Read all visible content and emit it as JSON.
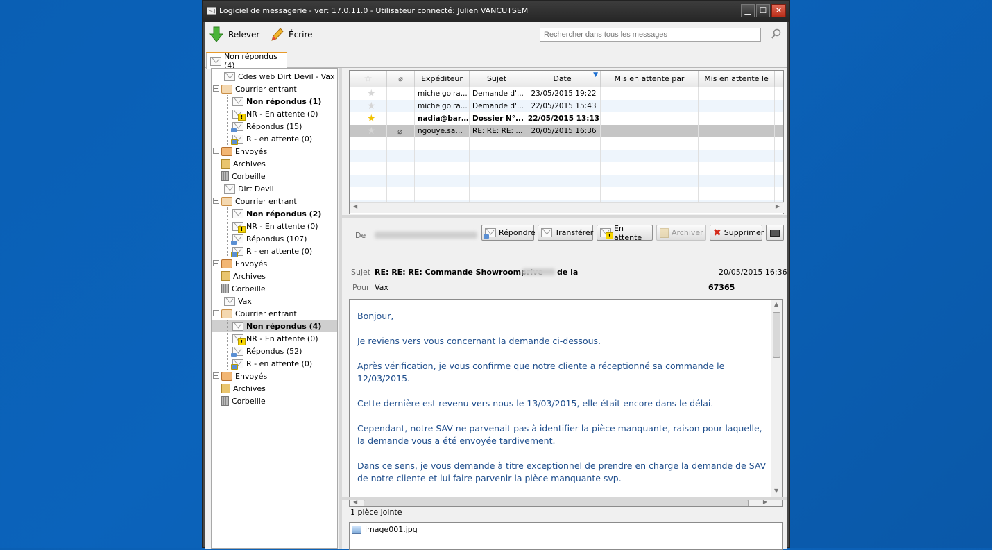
{
  "window": {
    "title": "Logiciel de messagerie - ver: 17.0.11.0 - Utilisateur connecté: Julien VANCUTSEM",
    "minimize": "▁",
    "maximize": "☐",
    "close": "✕"
  },
  "toolbar": {
    "fetch_label": "Relever",
    "write_label": "Écrire",
    "search_placeholder": "Rechercher dans tous les messages"
  },
  "tab": {
    "label": "Non répondus (4)"
  },
  "tree": [
    {
      "label": "Cdes web Dirt Devil - Vax",
      "icon": "mail-icon"
    },
    {
      "label": "Courrier entrant",
      "icon": "inbox-icon"
    },
    {
      "label": "Non répondus (1)",
      "icon": "envelope-icon"
    },
    {
      "label": "NR - En attente (0)",
      "icon": "envelope-warning-icon"
    },
    {
      "label": "Répondus (15)",
      "icon": "envelope-reply-icon"
    },
    {
      "label": "R - en attente (0)",
      "icon": "envelope-reply-warning-icon"
    },
    {
      "label": "Envoyés",
      "icon": "sent-icon"
    },
    {
      "label": "Archives",
      "icon": "archive-icon"
    },
    {
      "label": "Corbeille",
      "icon": "trash-icon"
    },
    {
      "label": "Dirt Devil",
      "icon": "mail-icon"
    },
    {
      "label": "Courrier entrant",
      "icon": "inbox-icon"
    },
    {
      "label": "Non répondus (2)",
      "icon": "envelope-icon"
    },
    {
      "label": "NR - En attente (0)",
      "icon": "envelope-warning-icon"
    },
    {
      "label": "Répondus (107)",
      "icon": "envelope-reply-icon"
    },
    {
      "label": "R - en attente (0)",
      "icon": "envelope-reply-warning-icon"
    },
    {
      "label": "Envoyés",
      "icon": "sent-icon"
    },
    {
      "label": "Archives",
      "icon": "archive-icon"
    },
    {
      "label": "Corbeille",
      "icon": "trash-icon"
    },
    {
      "label": "Vax",
      "icon": "mail-icon"
    },
    {
      "label": "Courrier entrant",
      "icon": "inbox-icon"
    },
    {
      "label": "Non répondus (4)",
      "icon": "envelope-icon"
    },
    {
      "label": "NR - En attente (0)",
      "icon": "envelope-warning-icon"
    },
    {
      "label": "Répondus (52)",
      "icon": "envelope-reply-icon"
    },
    {
      "label": "R - en attente (0)",
      "icon": "envelope-reply-warning-icon"
    },
    {
      "label": "Envoyés",
      "icon": "sent-icon"
    },
    {
      "label": "Archives",
      "icon": "archive-icon"
    },
    {
      "label": "Corbeille",
      "icon": "trash-icon"
    }
  ],
  "messages": {
    "columns": [
      "Expéditeur",
      "Sujet",
      "Date",
      "Mis en attente par",
      "Mis en attente le"
    ],
    "rows": [
      {
        "from": "michelgoira...",
        "subject": "Demande d'...",
        "date": "23/05/2015 19:22",
        "starred": false,
        "attachment": false
      },
      {
        "from": "michelgoira...",
        "subject": "Demande d'...",
        "date": "22/05/2015 15:43",
        "starred": false,
        "attachment": false
      },
      {
        "from": "nadia@barr...",
        "subject": "Dossier N°...",
        "date": "22/05/2015 13:13",
        "starred": true,
        "attachment": false
      },
      {
        "from": "ngouye.sam...",
        "subject": "RE: RE: RE: ...",
        "date": "20/05/2015 16:36",
        "starred": false,
        "attachment": true
      }
    ]
  },
  "preview": {
    "from_label": "De",
    "subject_label": "Sujet",
    "to_label": "Pour",
    "subject": "RE: RE: RE: Commande Showroomprive",
    "subject_suffix": "de la",
    "to": "Vax",
    "date": "20/05/2015 16:36",
    "ref": "67365",
    "buttons": {
      "reply": "Répondre",
      "forward": "Transférer",
      "pending": "En attente",
      "archive": "Archiver",
      "delete": "Supprimer"
    },
    "body": [
      "Bonjour,",
      "Je reviens vers vous concernant la demande ci-dessous.",
      "Après vérification, je vous confirme que notre cliente a réceptionné sa commande le 12/03/2015.",
      "Cette dernière est revenu vers nous le 13/03/2015, elle était encore dans le délai.",
      "Cependant, notre SAV ne parvenait pas à identifier la pièce manquante, raison pour laquelle, la demande vous a été envoyée tardivement.",
      "Dans ce sens, je vous demande à titre exceptionnel de prendre en charge la demande de SAV de notre cliente et lui faire parvenir la pièce manquante svp."
    ]
  },
  "attachments": {
    "title": "1 pièce jointe",
    "files": [
      "image001.jpg"
    ]
  }
}
